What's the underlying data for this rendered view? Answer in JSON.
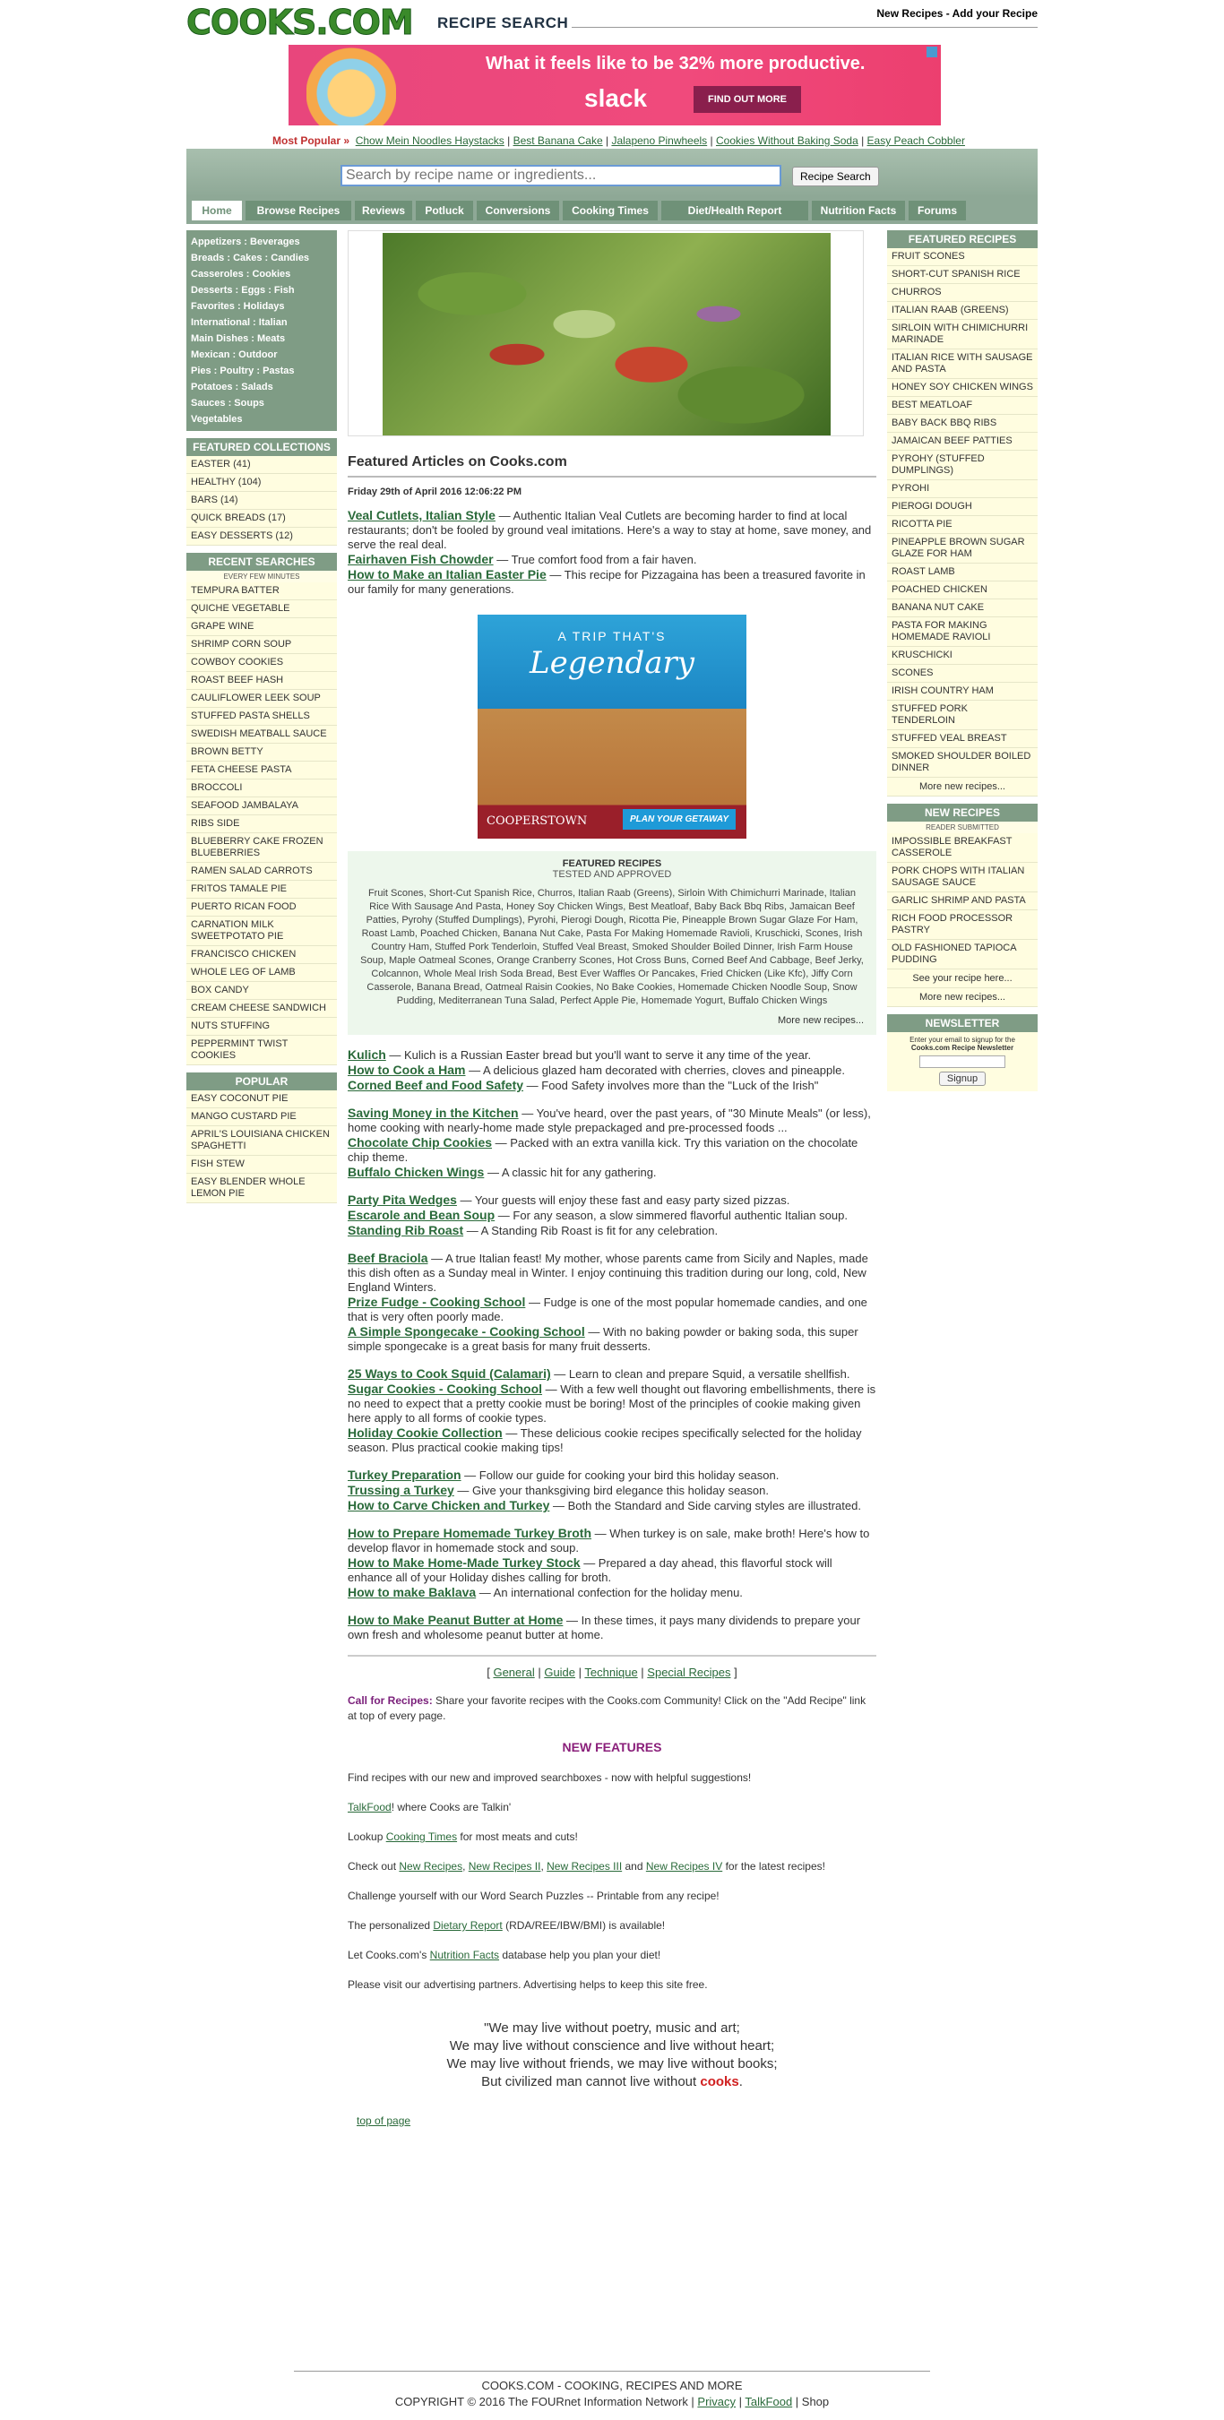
{
  "header": {
    "logo": "COOKS.COM",
    "subtitle": "RECIPE SEARCH",
    "links": "New Recipes - Add your Recipe"
  },
  "ad_top": {
    "headline": "What it feels like to be 32% more productive.",
    "brand": "slack",
    "cta": "FIND OUT MORE"
  },
  "most_popular": {
    "label": "Most Popular »",
    "items": [
      "Chow Mein Noodles Haystacks",
      "Best Banana Cake",
      "Jalapeno Pinwheels",
      "Cookies Without Baking Soda",
      "Easy Peach Cobbler"
    ]
  },
  "search": {
    "placeholder": "Search by recipe name or ingredients...",
    "button": "Recipe Search"
  },
  "nav": [
    "Home",
    "Browse Recipes",
    "Reviews",
    "Potluck",
    "Conversions",
    "Cooking Times",
    "Diet/Health Report",
    "Nutrition Facts",
    "Forums"
  ],
  "categories": [
    "Appetizers : Beverages",
    "Breads : Cakes : Candies",
    "Casseroles : Cookies",
    "Desserts : Eggs : Fish",
    "Favorites : Holidays",
    "International : Italian",
    "Main Dishes : Meats",
    "Mexican : Outdoor",
    "Pies : Poultry : Pastas",
    "Potatoes : Salads",
    "Sauces : Soups",
    "Vegetables"
  ],
  "featured_collections": {
    "title": "FEATURED COLLECTIONS",
    "items": [
      "EASTER (41)",
      "HEALTHY (104)",
      "BARS (14)",
      "QUICK BREADS (17)",
      "EASY DESSERTS (12)"
    ]
  },
  "recent_searches": {
    "title": "RECENT SEARCHES",
    "subtitle": "EVERY FEW MINUTES",
    "items": [
      "TEMPURA BATTER",
      "QUICHE VEGETABLE",
      "GRAPE WINE",
      "SHRIMP CORN SOUP",
      "COWBOY COOKIES",
      "ROAST BEEF HASH",
      "CAULIFLOWER LEEK SOUP",
      "STUFFED PASTA SHELLS",
      "SWEDISH MEATBALL SAUCE",
      "BROWN BETTY",
      "FETA CHEESE PASTA",
      "BROCCOLI",
      "SEAFOOD JAMBALAYA",
      "RIBS SIDE",
      "BLUEBERRY CAKE FROZEN BLUEBERRIES",
      "RAMEN SALAD CARROTS",
      "FRITOS TAMALE PIE",
      "PUERTO RICAN FOOD",
      "CARNATION MILK SWEETPOTATO PIE",
      "FRANCISCO CHICKEN",
      "WHOLE LEG OF LAMB",
      "BOX CANDY",
      "CREAM CHEESE SANDWICH",
      "NUTS STUFFING",
      "PEPPERMINT TWIST COOKIES"
    ]
  },
  "popular": {
    "title": "POPULAR",
    "items": [
      "EASY COCONUT PIE",
      "MANGO CUSTARD PIE",
      "APRIL'S LOUISIANA CHICKEN SPAGHETTI",
      "FISH STEW",
      "EASY BLENDER WHOLE LEMON PIE"
    ]
  },
  "featured_recipes": {
    "title": "FEATURED RECIPES",
    "items": [
      "FRUIT SCONES",
      "SHORT-CUT SPANISH RICE",
      "CHURROS",
      "ITALIAN RAAB (GREENS)",
      "SIRLOIN WITH CHIMICHURRI MARINADE",
      "ITALIAN RICE WITH SAUSAGE AND PASTA",
      "HONEY SOY CHICKEN WINGS",
      "BEST MEATLOAF",
      "BABY BACK BBQ RIBS",
      "JAMAICAN BEEF PATTIES",
      "PYROHY (STUFFED DUMPLINGS)",
      "PYROHI",
      "PIEROGI DOUGH",
      "RICOTTA PIE",
      "PINEAPPLE BROWN SUGAR GLAZE FOR HAM",
      "ROAST LAMB",
      "POACHED CHICKEN",
      "BANANA NUT CAKE",
      "PASTA FOR MAKING HOMEMADE RAVIOLI",
      "KRUSCHICKI",
      "SCONES",
      "IRISH COUNTRY HAM",
      "STUFFED PORK TENDERLOIN",
      "STUFFED VEAL BREAST",
      "SMOKED SHOULDER BOILED DINNER"
    ],
    "more": "More new recipes..."
  },
  "new_recipes": {
    "title": "NEW RECIPES",
    "subtitle": "READER SUBMITTED",
    "items": [
      "IMPOSSIBLE BREAKFAST CASSEROLE",
      "PORK CHOPS WITH ITALIAN SAUSAGE SAUCE",
      "GARLIC SHRIMP AND PASTA",
      "RICH FOOD PROCESSOR PASTRY",
      "OLD FASHIONED TAPIOCA PUDDING"
    ],
    "see": "See your recipe here...",
    "more": "More new recipes..."
  },
  "newsletter": {
    "title": "NEWSLETTER",
    "text": "Enter your email to signup for the",
    "text_bold": "Cooks.com Recipe Newsletter",
    "button": "Signup"
  },
  "center": {
    "title": "Featured Articles on Cooks.com",
    "date": "Friday 29th of April 2016 12:06:22 PM",
    "groups": [
      [
        {
          "link": "Veal Cutlets, Italian Style",
          "text": " — Authentic Italian Veal Cutlets are becoming harder to find at local restaurants; don't be fooled by ground veal imitations. Here's a way to stay at home, save money, and serve the real deal."
        },
        {
          "link": "Fairhaven Fish Chowder",
          "text": " — True comfort food from a fair haven."
        },
        {
          "link": "How to Make an Italian Easter Pie",
          "text": " — This recipe for Pizzagaina has been a treasured favorite in our family for many generations."
        }
      ]
    ],
    "ad_mid": {
      "line1": "A TRIP THAT'S",
      "line2": "Legendary",
      "brand": "COOPERSTOWN",
      "cta": "PLAN YOUR GETAWAY"
    },
    "featured_box": {
      "title": "FEATURED RECIPES",
      "subtitle": "TESTED AND APPROVED",
      "list": "Fruit Scones,  Short-Cut Spanish Rice,  Churros,  Italian Raab (Greens),  Sirloin With Chimichurri Marinade,  Italian Rice With Sausage And Pasta,  Honey Soy Chicken Wings,  Best Meatloaf,  Baby Back Bbq Ribs,  Jamaican Beef Patties,  Pyrohy (Stuffed Dumplings),  Pyrohi,  Pierogi Dough,  Ricotta Pie,  Pineapple Brown Sugar Glaze For Ham,  Roast Lamb,  Poached Chicken,  Banana Nut Cake,  Pasta For Making Homemade Ravioli,  Kruschicki,  Scones,  Irish Country Ham,  Stuffed Pork Tenderloin,  Stuffed Veal Breast,  Smoked Shoulder Boiled Dinner,  Irish Farm House Soup,  Maple Oatmeal Scones,  Orange Cranberry Scones,  Hot Cross Buns,  Corned Beef And Cabbage,  Beef Jerky,  Colcannon,  Whole Meal Irish Soda Bread,  Best Ever Waffles Or Pancakes,  Fried Chicken (Like Kfc),  Jiffy Corn Casserole,  Banana Bread,  Oatmeal Raisin Cookies,  No Bake Cookies,  Homemade Chicken Noodle Soup,  Snow Pudding,  Mediterranean Tuna Salad,  Perfect Apple Pie,  Homemade Yogurt,  Buffalo Chicken Wings",
      "more": "More new recipes..."
    },
    "groups2": [
      [
        {
          "link": "Kulich",
          "text": " — Kulich is a Russian Easter bread but you'll want to serve it any time of the year."
        },
        {
          "link": "How to Cook a Ham",
          "text": " — A delicious glazed ham decorated with cherries, cloves and pineapple."
        },
        {
          "link": "Corned Beef and Food Safety",
          "text": " — Food Safety involves more than the \"Luck of the Irish\""
        }
      ],
      [
        {
          "link": "Saving Money in the Kitchen",
          "text": " — You've heard, over the past years, of \"30 Minute Meals\" (or less), home cooking with nearly-home made style prepackaged and pre-processed foods ..."
        },
        {
          "link": "Chocolate Chip Cookies",
          "text": " — Packed with an extra vanilla kick. Try this variation on the chocolate chip theme."
        },
        {
          "link": "Buffalo Chicken Wings",
          "text": " — A classic hit for any gathering."
        }
      ],
      [
        {
          "link": "Party Pita Wedges",
          "text": " — Your guests will enjoy these fast and easy party sized pizzas."
        },
        {
          "link": "Escarole and Bean Soup",
          "text": " — For any season, a slow simmered flavorful authentic Italian soup."
        },
        {
          "link": "Standing Rib Roast",
          "text": " — A Standing Rib Roast is fit for any celebration."
        }
      ],
      [
        {
          "link": "Beef Braciola",
          "text": " — A true Italian feast! My mother, whose parents came from Sicily and Naples, made this dish often as a Sunday meal in Winter. I enjoy continuing this tradition during our long, cold, New England Winters."
        },
        {
          "link": "Prize Fudge - Cooking School",
          "text": " — Fudge is one of the most popular homemade candies, and one that is very often poorly made."
        },
        {
          "link": "A Simple Spongecake - Cooking School",
          "text": " — With no baking powder or baking soda, this super simple spongecake is a great basis for many fruit desserts."
        }
      ],
      [
        {
          "link": "25 Ways to Cook Squid (Calamari)",
          "text": " — Learn to clean and prepare Squid, a versatile shellfish."
        },
        {
          "link": "Sugar Cookies - Cooking School",
          "text": " — With a few well thought out flavoring embellishments, there is no need to expect that a pretty cookie must be boring! Most of the principles of cookie making given here apply to all forms of cookie types."
        },
        {
          "link": "Holiday Cookie Collection",
          "text": " — These delicious cookie recipes specifically selected for the holiday season. Plus practical cookie making tips!"
        }
      ],
      [
        {
          "link": "Turkey Preparation",
          "text": " — Follow our guide for cooking your bird this holiday season."
        },
        {
          "link": "Trussing a Turkey",
          "text": " — Give your thanksgiving bird elegance this holiday season."
        },
        {
          "link": "How to Carve Chicken and Turkey",
          "text": " — Both the Standard and Side carving styles are illustrated."
        }
      ],
      [
        {
          "link": "How to Prepare Homemade Turkey Broth",
          "text": " — When turkey is on sale, make broth! Here's how to develop flavor in homemade stock and soup."
        },
        {
          "link": "How to Make Home-Made Turkey Stock",
          "text": " — Prepared a day ahead, this flavorful stock will enhance all of your Holiday dishes calling for broth."
        },
        {
          "link": "How to make Baklava",
          "text": " — An international confection for the holiday menu."
        }
      ],
      [
        {
          "link": "How to Make Peanut Butter at Home",
          "text": " — In these times, it pays many dividends to prepare your own fresh and wholesome peanut butter at home."
        }
      ]
    ],
    "category_links": [
      "[ ",
      "General",
      " | ",
      "Guide",
      " | ",
      "Technique",
      " | ",
      "Special Recipes",
      " ]"
    ],
    "call_label": "Call for Recipes:",
    "call_text": " Share your favorite recipes with the Cooks.com Community!  Click on the \"Add Recipe\" link at top of every page.",
    "new_features": "NEW FEATURES",
    "features": {
      "f1": "Find recipes with our new and improved searchboxes - now with helpful suggestions!",
      "f2_link": "TalkFood",
      "f2_text": "! where Cooks are Talkin'",
      "f3_pre": "Lookup ",
      "f3_link": "Cooking Times",
      "f3_post": " for most meats and cuts!",
      "f4_pre": "Check out ",
      "f4_l1": "New Recipes",
      "f4_l2": "New Recipes II",
      "f4_l3": "New Recipes III",
      "f4_l4": "New Recipes IV",
      "f4_post": " for the latest recipes!",
      "f5": "Challenge yourself with our Word Search Puzzles -- Printable from any recipe!",
      "f6_pre": "The personalized ",
      "f6_link": "Dietary Report",
      "f6_post": " (RDA/REE/IBW/BMI) is available!",
      "f7_pre": "Let Cooks.com's ",
      "f7_link": "Nutrition Facts",
      "f7_post": " database help you plan your diet!",
      "f8": "Please visit our advertising partners.  Advertising helps to keep this site free."
    },
    "quote": {
      "l1": "\"We may live without poetry, music and art;",
      "l2": "We may live without conscience and live without heart;",
      "l3": "We may live without friends, we may live without books;",
      "l4": "But civilized man cannot live without ",
      "cooks": "cooks",
      "end": "."
    },
    "top_link": "top of page"
  },
  "footer": {
    "line1": "COOKS.COM - COOKING, RECIPES AND MORE",
    "line2_pre": "COPYRIGHT © 2016 The FOURnet Information Network | ",
    "privacy": "Privacy",
    "talkfood": "TalkFood",
    "shop": "Shop"
  }
}
